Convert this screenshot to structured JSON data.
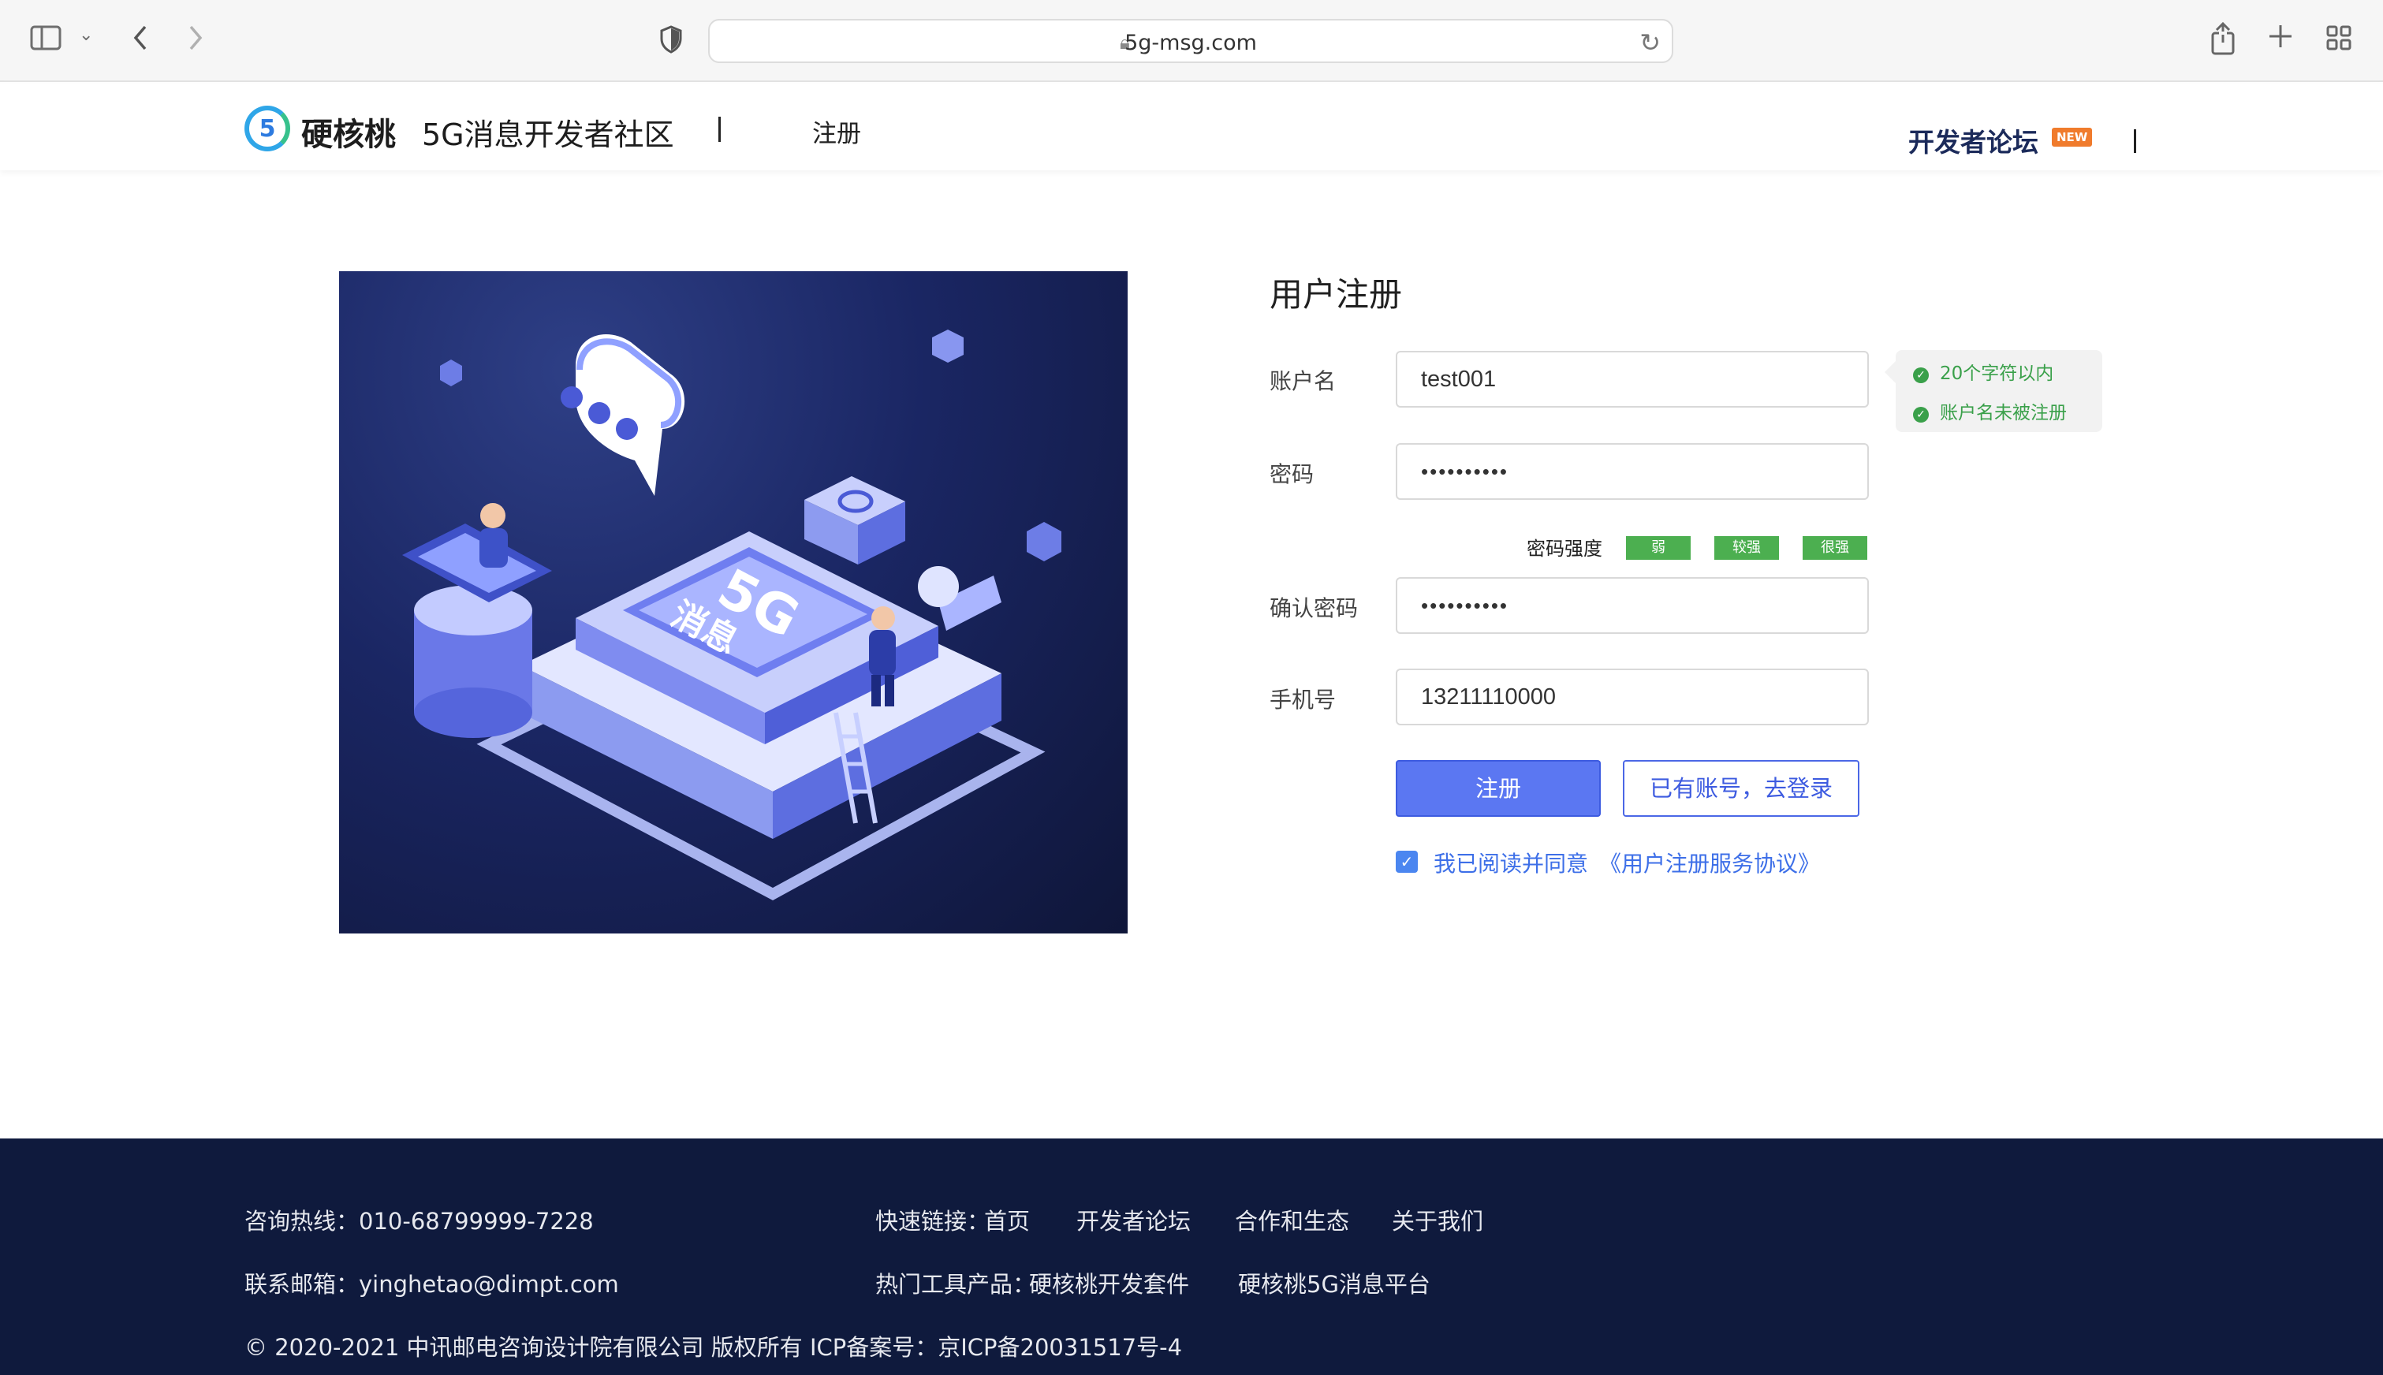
{
  "browser": {
    "url": "5g-msg.com",
    "icons": [
      "sidebar-icon",
      "chevron-down-icon",
      "back-icon",
      "forward-icon",
      "shield-icon",
      "lock-icon",
      "reload-icon",
      "share-icon",
      "new-tab-icon",
      "tab-overview-icon"
    ]
  },
  "header": {
    "brand_name": "硬核桃",
    "brand_sub": "5G消息开发者社区",
    "page_name": "注册",
    "forum_label": "开发者论坛",
    "new_badge": "NEW",
    "logo_digit": "5"
  },
  "illustration": {
    "label_top": "5G",
    "label_bottom": "消息"
  },
  "form": {
    "title": "用户注册",
    "account_label": "账户名",
    "account_value": "test001",
    "password_label": "密码",
    "password_value": "••••••••••",
    "strength_label": "密码强度",
    "strength_levels": [
      "弱",
      "较强",
      "很强"
    ],
    "confirm_label": "确认密码",
    "confirm_value": "••••••••••",
    "phone_label": "手机号",
    "phone_value": "13211110000",
    "register_button": "注册",
    "login_button": "已有账号，去登录",
    "agree_text": "我已阅读并同意",
    "agree_link": "《用户注册服务协议》",
    "tips": [
      "20个字符以内",
      "账户名未被注册"
    ]
  },
  "footer": {
    "hotline": "咨询热线：010-68799999-7228",
    "email": "联系邮箱：yinghetao@dimpt.com",
    "copyright": "© 2020-2021 中讯邮电咨询设计院有限公司 版权所有 ICP备案号：京ICP备20031517号-4",
    "quick_links_label": "快速链接：",
    "quick_links": [
      "首页",
      "开发者论坛",
      "合作和生态",
      "关于我们"
    ],
    "tools_label": "热门工具产品：",
    "tools": [
      "硬核桃开发套件",
      "硬核桃5G消息平台"
    ]
  },
  "colors": {
    "primary": "#5b77f2",
    "footer_bg": "#0f1a3d",
    "success": "#3aa04a",
    "strength": "#4caf50",
    "badge": "#f07b2c"
  }
}
